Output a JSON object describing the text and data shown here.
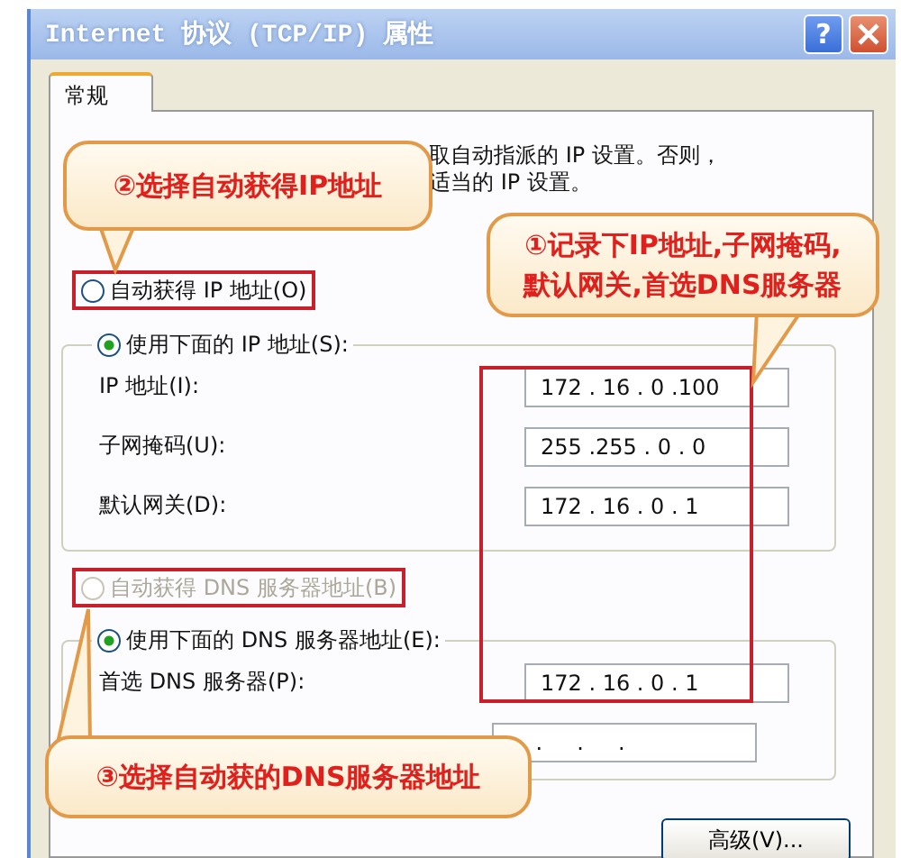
{
  "window": {
    "title": "Internet 协议 (TCP/IP) 属性",
    "buttons": [
      {
        "kind": "help",
        "label": "?"
      },
      {
        "kind": "close"
      }
    ]
  },
  "tabs": [
    {
      "label": "常规",
      "selected": true
    }
  ],
  "description": [
    "取自动指派的 IP 设置。否则，",
    "适当的 IP 设置。"
  ],
  "ip_section": {
    "auto_option": {
      "label": "自动获得 IP 地址(O)",
      "selected": false,
      "disabled": false,
      "highlighted": true
    },
    "manual_option": {
      "label": "使用下面的 IP 地址(S):",
      "selected": true
    },
    "fields": [
      {
        "label": "IP 地址(I):",
        "value": "172 . 16 . 0 .100"
      },
      {
        "label": "子网掩码(U):",
        "value": "255 .255 . 0 . 0"
      },
      {
        "label": "默认网关(D):",
        "value": "172 . 16 . 0 . 1"
      }
    ]
  },
  "dns_section": {
    "auto_option": {
      "label": "自动获得 DNS 服务器地址(B)",
      "selected": false,
      "disabled": true,
      "highlighted": true
    },
    "manual_option": {
      "label": "使用下面的 DNS 服务器地址(E):",
      "selected": true
    },
    "fields": [
      {
        "label": "首选 DNS 服务器(P):",
        "value": "172 . 16 . 0 . 1"
      },
      {
        "value": "    .     .     ."
      }
    ]
  },
  "fields_highlighted": true,
  "callouts": [
    {
      "lines": [
        "②选择自动获得IP地址"
      ]
    },
    {
      "lines": [
        "①记录下IP地址,子网掩码,",
        "默认网关,首选DNS服务器"
      ]
    },
    {
      "lines": [
        "③选择自动获的DNS服务器地址"
      ]
    }
  ],
  "buttons": [
    {
      "label": "高级(V)..."
    }
  ]
}
